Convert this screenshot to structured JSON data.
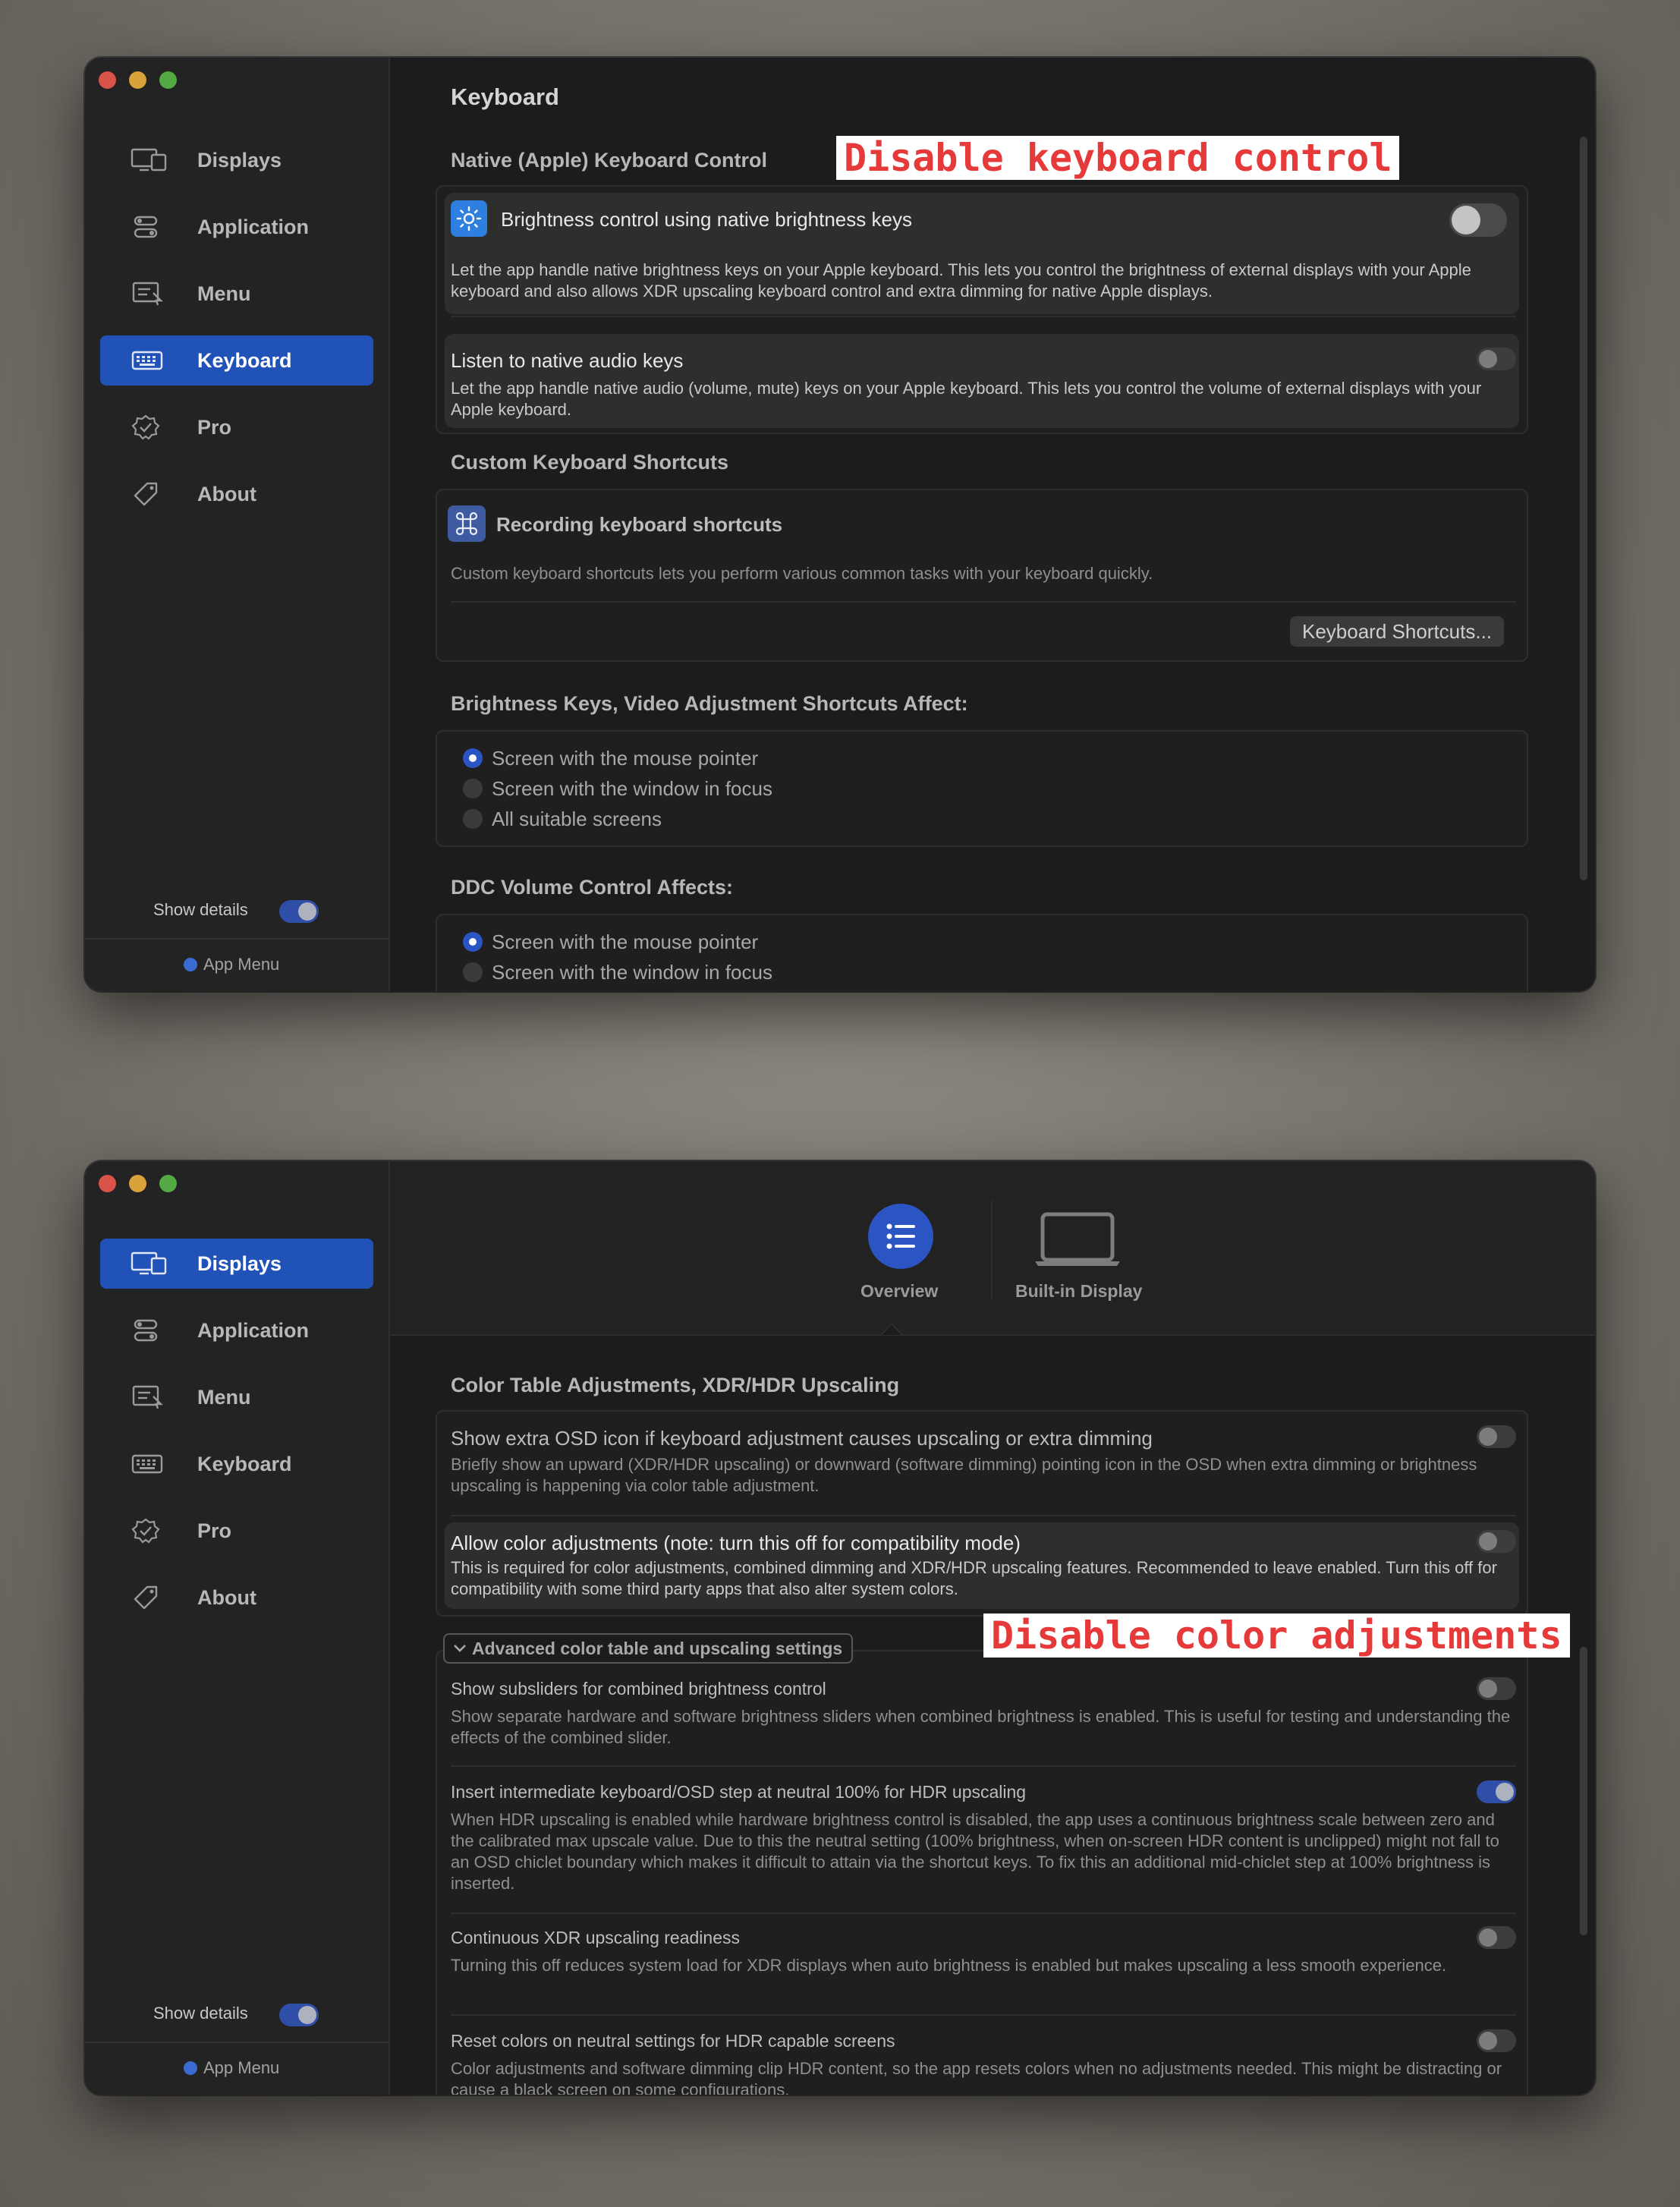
{
  "sidebar": {
    "items": [
      {
        "label": "Displays",
        "icon": "displays-icon"
      },
      {
        "label": "Application",
        "icon": "application-icon"
      },
      {
        "label": "Menu",
        "icon": "menu-icon"
      },
      {
        "label": "Keyboard",
        "icon": "keyboard-icon"
      },
      {
        "label": "Pro",
        "icon": "pro-icon"
      },
      {
        "label": "About",
        "icon": "about-icon"
      }
    ],
    "show_details_label": "Show details",
    "app_menu_label": "App Menu"
  },
  "window1": {
    "active_item": "Keyboard",
    "page_title": "Keyboard",
    "native_section": "Native (Apple) Keyboard Control",
    "brightness_row": {
      "title": "Brightness control using native brightness keys",
      "desc": "Let the app handle native brightness keys on your Apple keyboard. This lets you control the brightness of external displays with your Apple keyboard and also allows XDR upscaling keyboard control and extra dimming for native Apple displays."
    },
    "audio_row": {
      "title": "Listen to native audio keys",
      "desc": "Let the app handle native audio (volume, mute) keys on your Apple keyboard. This lets you control the volume of external displays with your Apple keyboard."
    },
    "custom_section": "Custom Keyboard Shortcuts",
    "recording": {
      "title": "Recording keyboard shortcuts",
      "desc": "Custom keyboard shortcuts lets you perform various common tasks with your keyboard quickly.",
      "button": "Keyboard Shortcuts..."
    },
    "brightness_affect": {
      "title": "Brightness Keys, Video Adjustment Shortcuts Affect:",
      "options": [
        "Screen with the mouse pointer",
        "Screen with the window in focus",
        "All suitable screens"
      ]
    },
    "ddc_affect": {
      "title": "DDC Volume Control Affects:",
      "options": [
        "Screen with the mouse pointer",
        "Screen with the window in focus"
      ]
    },
    "annotation": "Disable keyboard control"
  },
  "window2": {
    "active_item": "Displays",
    "tabs": [
      {
        "label": "Overview",
        "icon": "list-icon"
      },
      {
        "label": "Built-in Display",
        "icon": "laptop-icon"
      }
    ],
    "section": "Color Table Adjustments, XDR/HDR Upscaling",
    "osd_row": {
      "title": "Show extra OSD icon if keyboard adjustment causes upscaling or extra dimming",
      "desc": "Briefly show an upward (XDR/HDR upscaling) or downward (software dimming) pointing icon in the OSD when extra dimming or brightness upscaling is happening via color table adjustment."
    },
    "color_row": {
      "title": "Allow color adjustments (note: turn this off for compatibility mode)",
      "desc": "This is required for color adjustments, combined dimming and XDR/HDR upscaling features. Recommended to leave enabled. Turn this off for compatibility with some third party apps that also alter system colors."
    },
    "advanced_label": "Advanced color table and upscaling settings",
    "annotation": "Disable color adjustments",
    "advanced_rows": [
      {
        "title": "Show subsliders for combined brightness control",
        "desc": "Show separate hardware and software brightness sliders when combined brightness is enabled. This is useful for testing and understanding the effects of the combined slider.",
        "on": false
      },
      {
        "title": "Insert intermediate keyboard/OSD step at neutral 100% for HDR upscaling",
        "desc": "When HDR upscaling is enabled while hardware brightness control is disabled, the app uses a continuous brightness scale between zero and the calibrated max upscale value. Due to this the neutral setting (100% brightness, when on-screen HDR content is unclipped) might not fall to an OSD chiclet boundary which makes it difficult to attain via the shortcut keys. To fix this an additional mid-chiclet step at 100% brightness is inserted.",
        "on": true
      },
      {
        "title": "Continuous XDR upscaling readiness",
        "desc": "Turning this off reduces system load for XDR displays when auto brightness is enabled but makes upscaling a less smooth experience.",
        "on": false
      },
      {
        "title": "Reset colors on neutral settings for HDR capable screens",
        "desc": "Color adjustments and software dimming clip HDR content, so the app resets colors when no adjustments needed. This might be distracting or cause a black screen on some configurations.",
        "on": false
      }
    ]
  }
}
